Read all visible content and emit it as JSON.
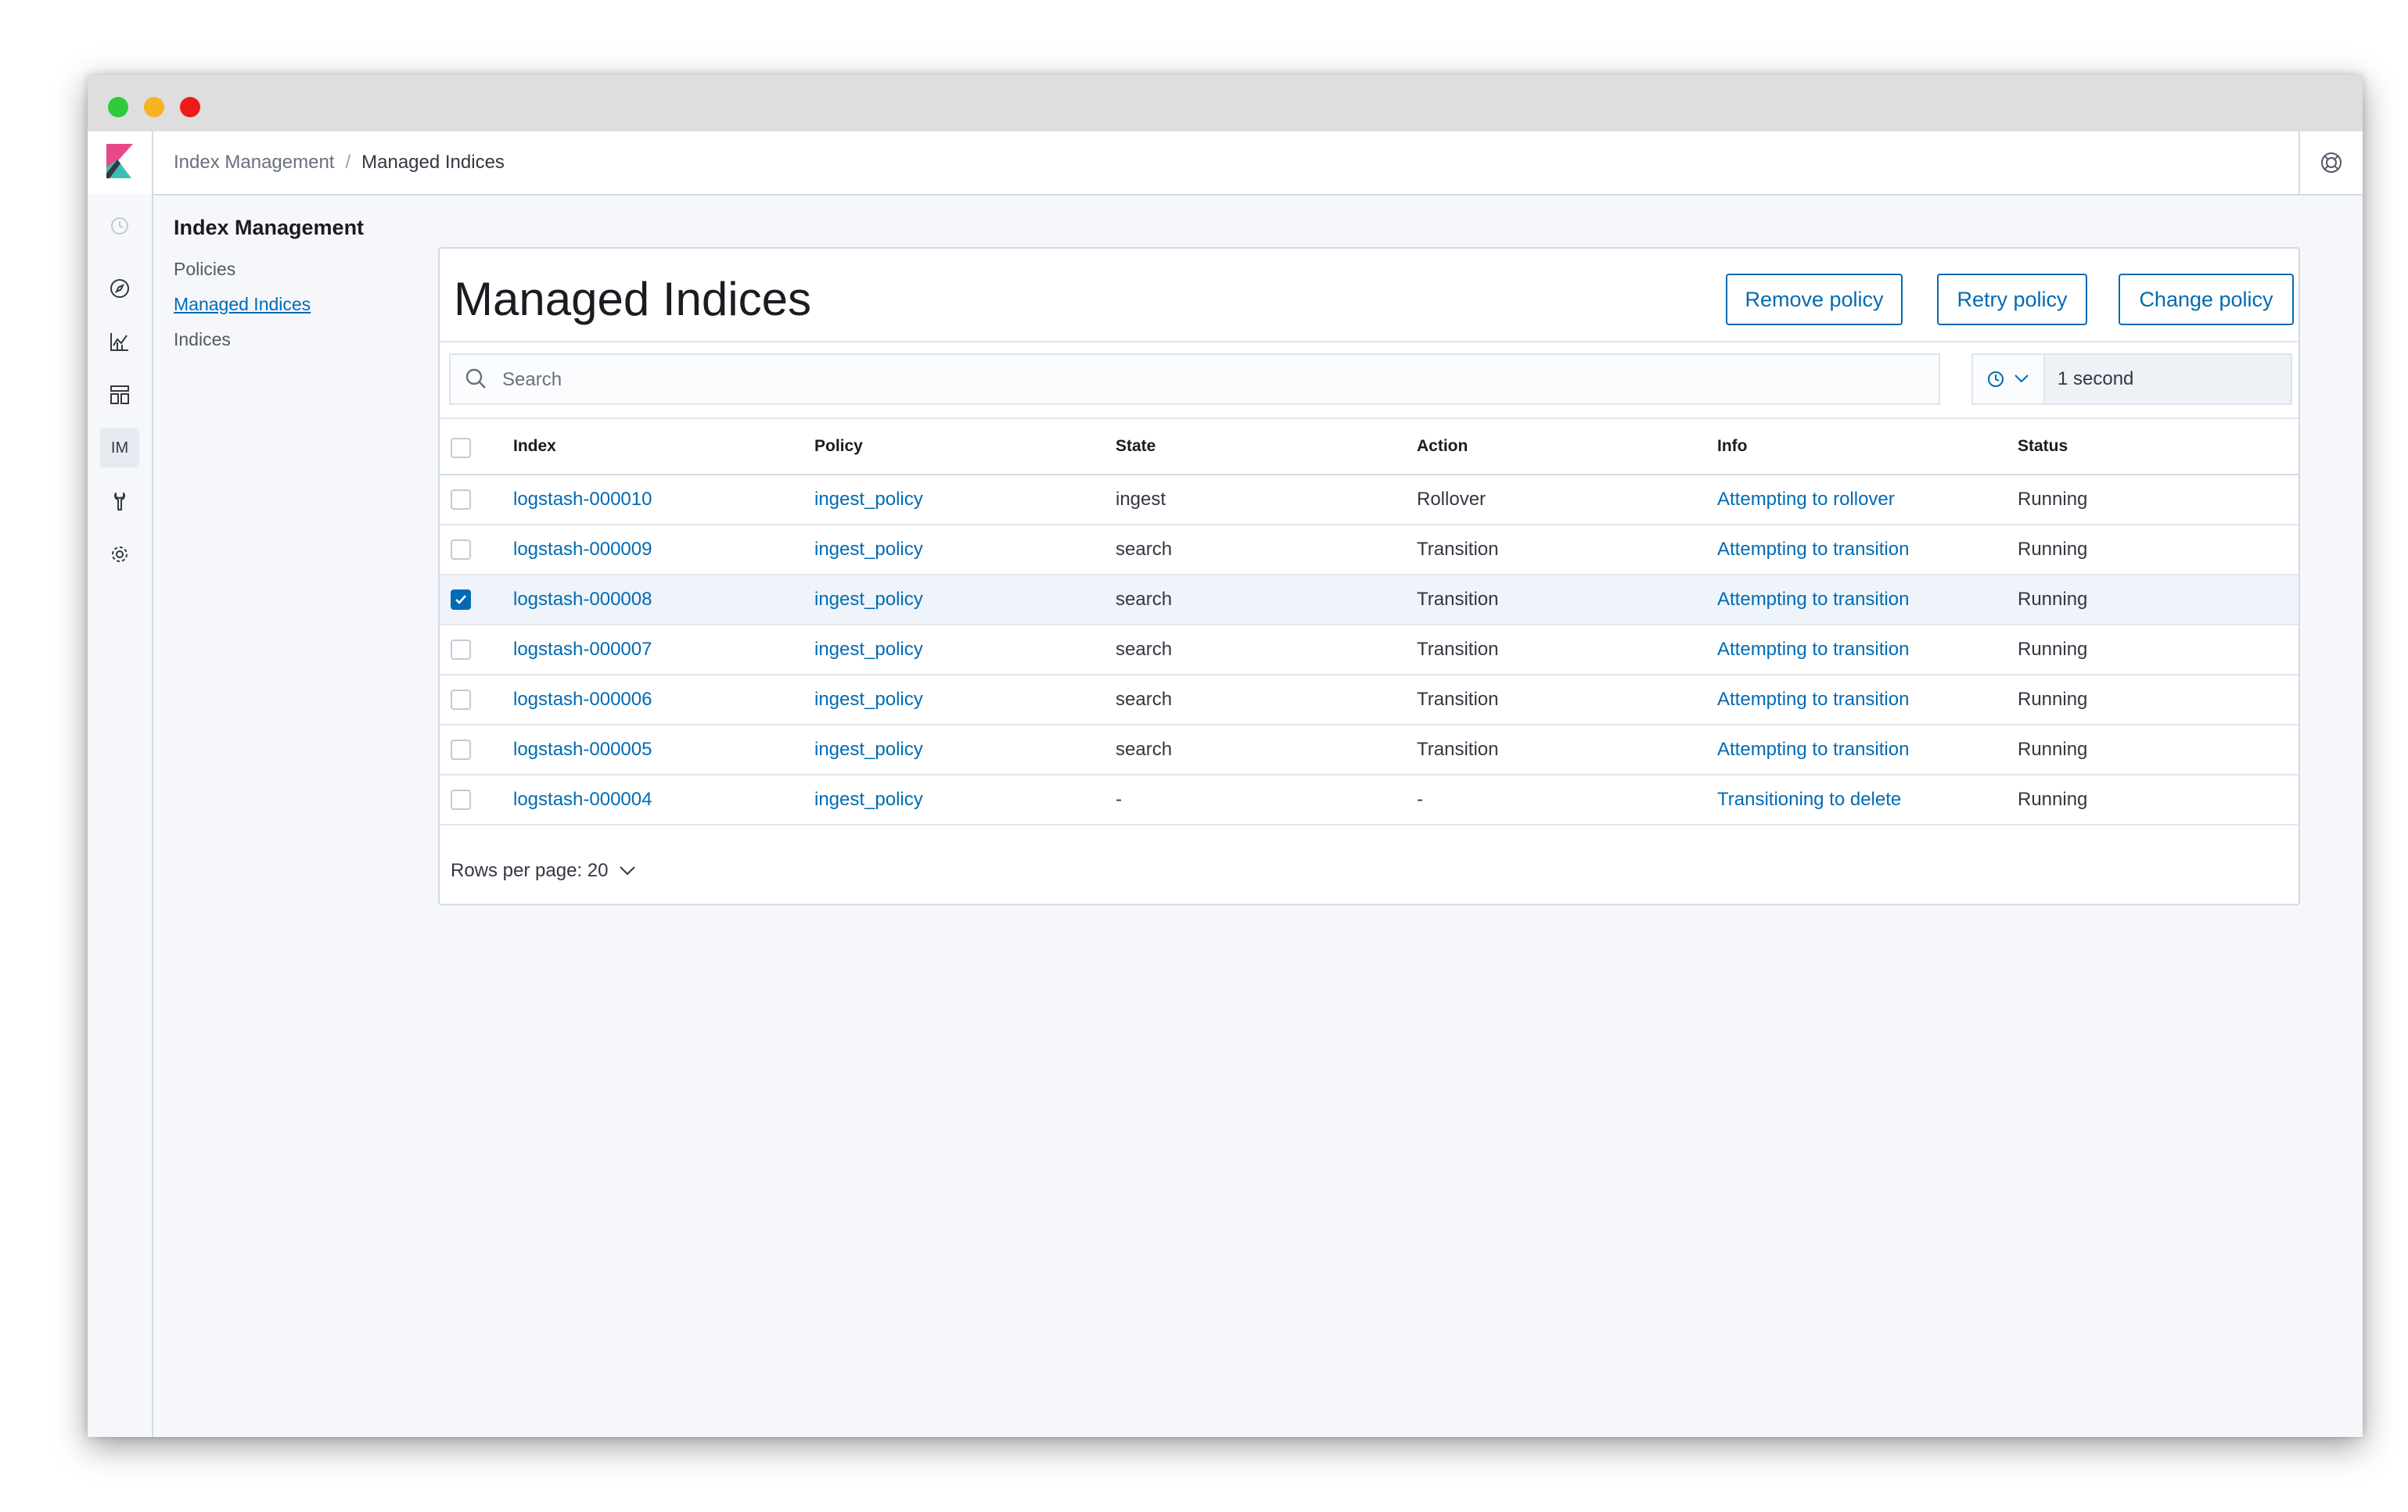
{
  "header": {
    "breadcrumbs": [
      "Index Management",
      "Managed Indices"
    ]
  },
  "sidebar": {
    "icons": [
      "clock-icon",
      "compass-icon",
      "chart-icon",
      "dashboard-icon",
      "im-icon",
      "wrench-icon",
      "gear-icon"
    ],
    "im_label": "IM"
  },
  "subnav": {
    "title": "Index Management",
    "items": [
      {
        "label": "Policies",
        "selected": false
      },
      {
        "label": "Managed Indices",
        "selected": true
      },
      {
        "label": "Indices",
        "selected": false
      }
    ]
  },
  "main": {
    "title": "Managed Indices",
    "buttons": {
      "remove": "Remove policy",
      "retry": "Retry policy",
      "change": "Change policy"
    },
    "search_placeholder": "Search",
    "refresh_interval": "1 second",
    "columns": [
      "Index",
      "Policy",
      "State",
      "Action",
      "Info",
      "Status"
    ],
    "rows": [
      {
        "index": "logstash-000010",
        "policy": "ingest_policy",
        "state": "ingest",
        "action": "Rollover",
        "info": "Attempting to rollover",
        "status": "Running",
        "checked": false
      },
      {
        "index": "logstash-000009",
        "policy": "ingest_policy",
        "state": "search",
        "action": "Transition",
        "info": "Attempting to transition",
        "status": "Running",
        "checked": false
      },
      {
        "index": "logstash-000008",
        "policy": "ingest_policy",
        "state": "search",
        "action": "Transition",
        "info": "Attempting to transition",
        "status": "Running",
        "checked": true
      },
      {
        "index": "logstash-000007",
        "policy": "ingest_policy",
        "state": "search",
        "action": "Transition",
        "info": "Attempting to transition",
        "status": "Running",
        "checked": false
      },
      {
        "index": "logstash-000006",
        "policy": "ingest_policy",
        "state": "search",
        "action": "Transition",
        "info": "Attempting to transition",
        "status": "Running",
        "checked": false
      },
      {
        "index": "logstash-000005",
        "policy": "ingest_policy",
        "state": "search",
        "action": "Transition",
        "info": "Attempting to transition",
        "status": "Running",
        "checked": false
      },
      {
        "index": "logstash-000004",
        "policy": "ingest_policy",
        "state": "-",
        "action": "-",
        "info": "Transitioning to delete",
        "status": "Running",
        "checked": false
      }
    ],
    "rows_per_page_label": "Rows per page: 20"
  },
  "colors": {
    "link": "#006bb4",
    "accent_pink": "#e8488b",
    "accent_teal": "#3ebeb0"
  }
}
